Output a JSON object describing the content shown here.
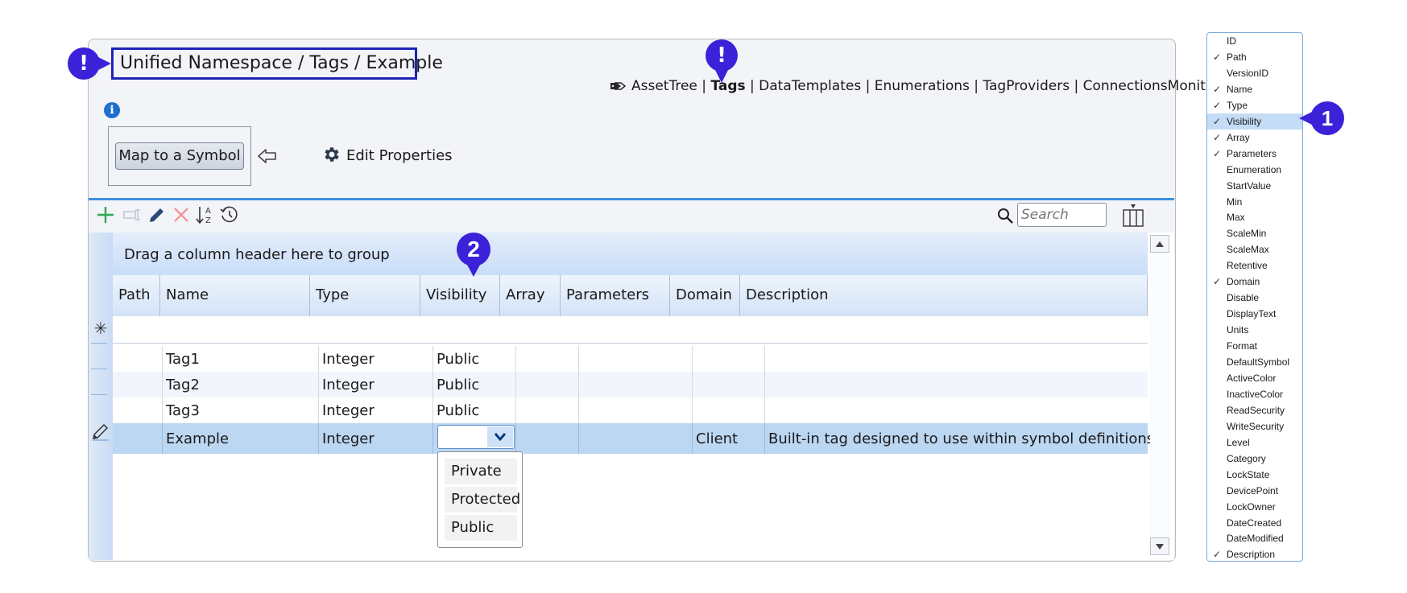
{
  "breadcrumb": "Unified Namespace / Tags / Example",
  "callouts": {
    "top_left": "!",
    "tags": "!",
    "column_list": "1",
    "visibility_header": "2"
  },
  "nav": {
    "links": [
      "AssetTree",
      "Tags",
      "DataTemplates",
      "Enumerations",
      "TagProviders",
      "ConnectionsMonitor"
    ],
    "separator": "|",
    "active": "Tags"
  },
  "info_icon": "i",
  "actions": {
    "map_symbol": "Map to a Symbol",
    "edit_properties": "Edit Properties"
  },
  "search": {
    "placeholder": "Search",
    "value": ""
  },
  "grid": {
    "group_panel": "Drag a column header here to group",
    "columns": [
      "Path",
      "Name",
      "Type",
      "Visibility",
      "Array",
      "Parameters",
      "Domain",
      "Description"
    ],
    "new_row_marker": "✳",
    "rows": [
      {
        "path": "",
        "name": "Tag1",
        "type": "Integer",
        "visibility": "Public",
        "array": "",
        "parameters": "",
        "domain": "",
        "description": ""
      },
      {
        "path": "",
        "name": "Tag2",
        "type": "Integer",
        "visibility": "Public",
        "array": "",
        "parameters": "",
        "domain": "",
        "description": ""
      },
      {
        "path": "",
        "name": "Tag3",
        "type": "Integer",
        "visibility": "Public",
        "array": "",
        "parameters": "",
        "domain": "",
        "description": ""
      },
      {
        "path": "",
        "name": "Example",
        "type": "Integer",
        "visibility": "",
        "array": "",
        "parameters": "",
        "domain": "Client",
        "description": "Built-in tag designed to use within symbol definitions"
      }
    ],
    "visibility_options": [
      "Private",
      "Protected",
      "Public"
    ]
  },
  "column_chooser": {
    "items": [
      {
        "label": "ID",
        "checked": false
      },
      {
        "label": "Path",
        "checked": true
      },
      {
        "label": "VersionID",
        "checked": false
      },
      {
        "label": "Name",
        "checked": true
      },
      {
        "label": "Type",
        "checked": true
      },
      {
        "label": "Visibility",
        "checked": true
      },
      {
        "label": "Array",
        "checked": true
      },
      {
        "label": "Parameters",
        "checked": true
      },
      {
        "label": "Enumeration",
        "checked": false
      },
      {
        "label": "StartValue",
        "checked": false
      },
      {
        "label": "Min",
        "checked": false
      },
      {
        "label": "Max",
        "checked": false
      },
      {
        "label": "ScaleMin",
        "checked": false
      },
      {
        "label": "ScaleMax",
        "checked": false
      },
      {
        "label": "Retentive",
        "checked": false
      },
      {
        "label": "Domain",
        "checked": true
      },
      {
        "label": "Disable",
        "checked": false
      },
      {
        "label": "DisplayText",
        "checked": false
      },
      {
        "label": "Units",
        "checked": false
      },
      {
        "label": "Format",
        "checked": false
      },
      {
        "label": "DefaultSymbol",
        "checked": false
      },
      {
        "label": "ActiveColor",
        "checked": false
      },
      {
        "label": "InactiveColor",
        "checked": false
      },
      {
        "label": "ReadSecurity",
        "checked": false
      },
      {
        "label": "WriteSecurity",
        "checked": false
      },
      {
        "label": "Level",
        "checked": false
      },
      {
        "label": "Category",
        "checked": false
      },
      {
        "label": "LockState",
        "checked": false
      },
      {
        "label": "DevicePoint",
        "checked": false
      },
      {
        "label": "LockOwner",
        "checked": false
      },
      {
        "label": "DateCreated",
        "checked": false
      },
      {
        "label": "DateModified",
        "checked": false
      },
      {
        "label": "Description",
        "checked": true
      }
    ],
    "highlighted": "Visibility",
    "check_glyph": "✓"
  },
  "colors": {
    "callout": "#3b22d8",
    "accent_blue": "#3d8fe0",
    "selected_row": "#bcd7f2",
    "add_green": "#2fa84f",
    "delete_red": "#f08a8a"
  },
  "icons": [
    "tag-icon",
    "info-icon",
    "arrow-left-icon",
    "gear-icon",
    "add-icon",
    "rename-icon",
    "edit-icon",
    "delete-icon",
    "sort-az-icon",
    "history-icon",
    "search-icon",
    "column-chooser-icon",
    "pencil-icon",
    "chevron-down-icon"
  ]
}
